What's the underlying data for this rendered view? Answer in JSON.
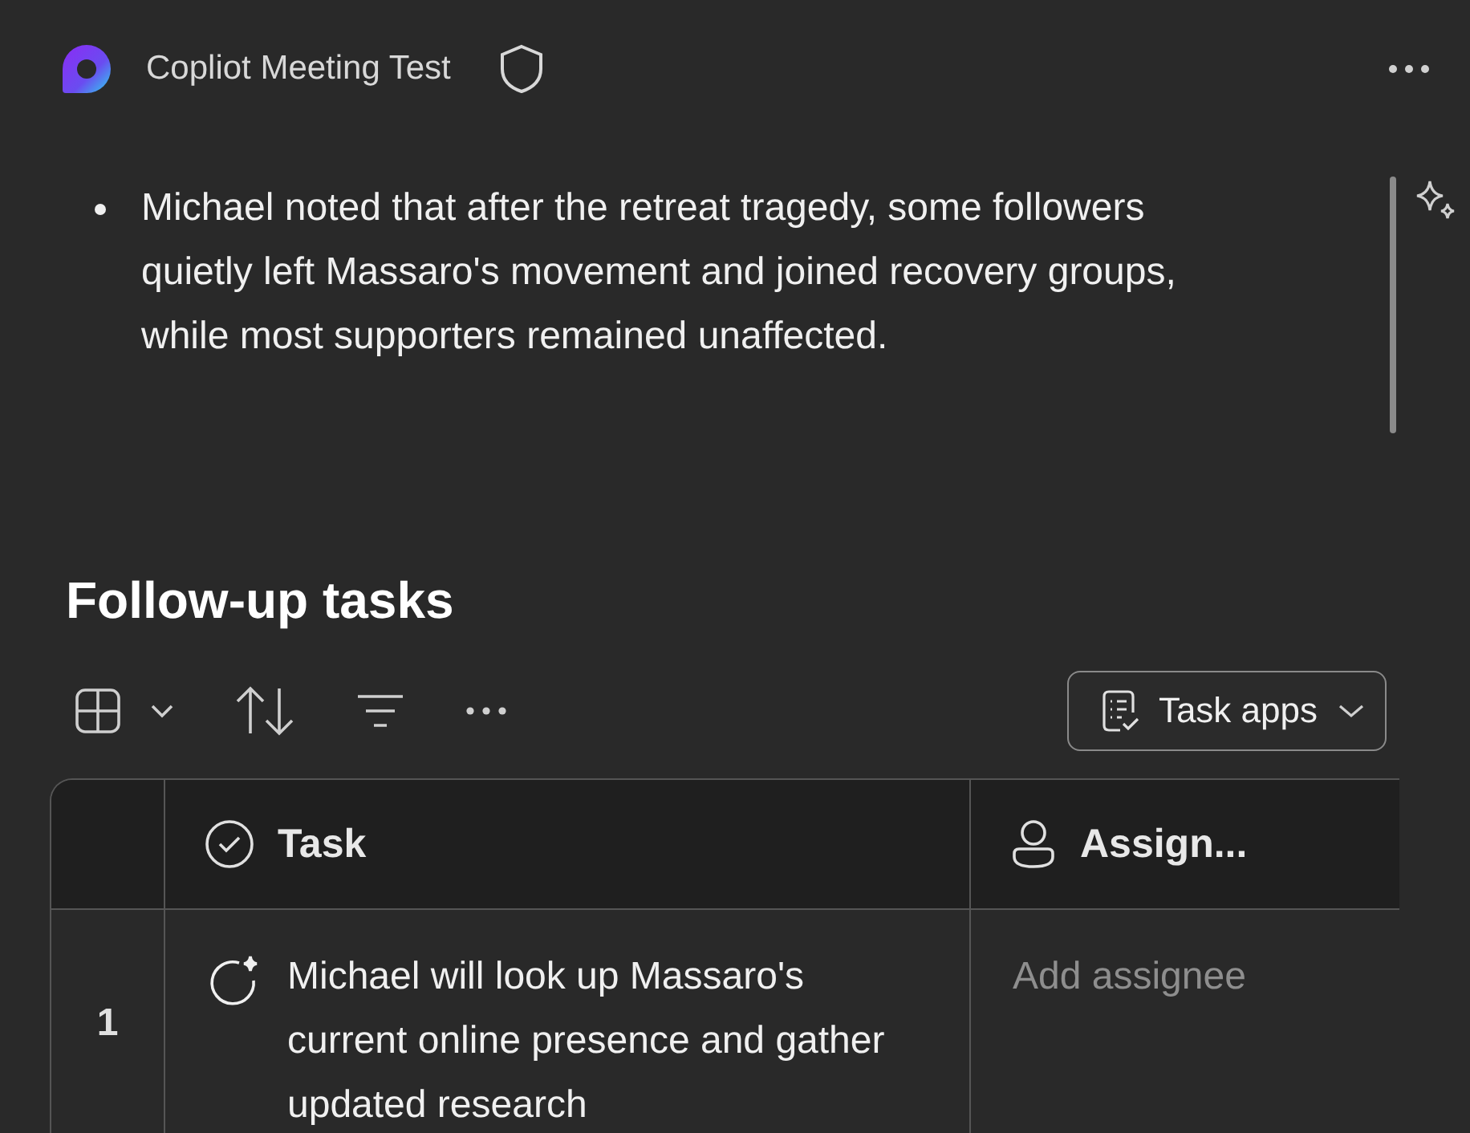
{
  "header": {
    "title": "Copliot Meeting Test"
  },
  "notes": [
    "Michael noted that after the retreat tragedy, some followers quietly left Massaro's movement and joined recovery groups, while most supporters remained unaffected."
  ],
  "tasks_section": {
    "title": "Follow-up tasks",
    "task_apps_button": "Task apps"
  },
  "table": {
    "columns": [
      "Task",
      "Assign..."
    ],
    "rows": [
      {
        "number": "1",
        "task": "Michael will look up Massaro's current online presence and gather updated research",
        "assignee_placeholder": "Add assignee"
      }
    ]
  }
}
